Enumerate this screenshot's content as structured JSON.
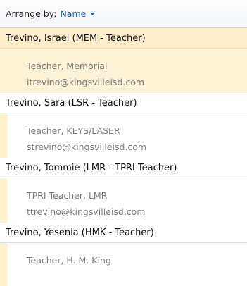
{
  "arrange": {
    "label": "Arrange by:",
    "value": "Name"
  },
  "contacts": [
    {
      "name": "Trevino, Israel (MEM - Teacher)",
      "title": "Teacher, Memorial",
      "email": "itrevino@kingsvilleisd.com"
    },
    {
      "name": "Trevino, Sara (LSR - Teacher)",
      "title": "Teacher, KEYS/LASER",
      "email": "strevino@kingsvilleisd.com"
    },
    {
      "name": "Trevino, Tommie (LMR - TPRI Teacher)",
      "title": "TPRI Teacher, LMR",
      "email": "ttrevino@kingsvilleisd.com"
    },
    {
      "name": "Trevino, Yesenia (HMK - Teacher)",
      "title": "Teacher, H. M. King",
      "email": ""
    }
  ],
  "colors": {
    "accent": "#1f5fbf",
    "selected_header": "#fcedc9",
    "selected_body": "#fbf1d7"
  }
}
